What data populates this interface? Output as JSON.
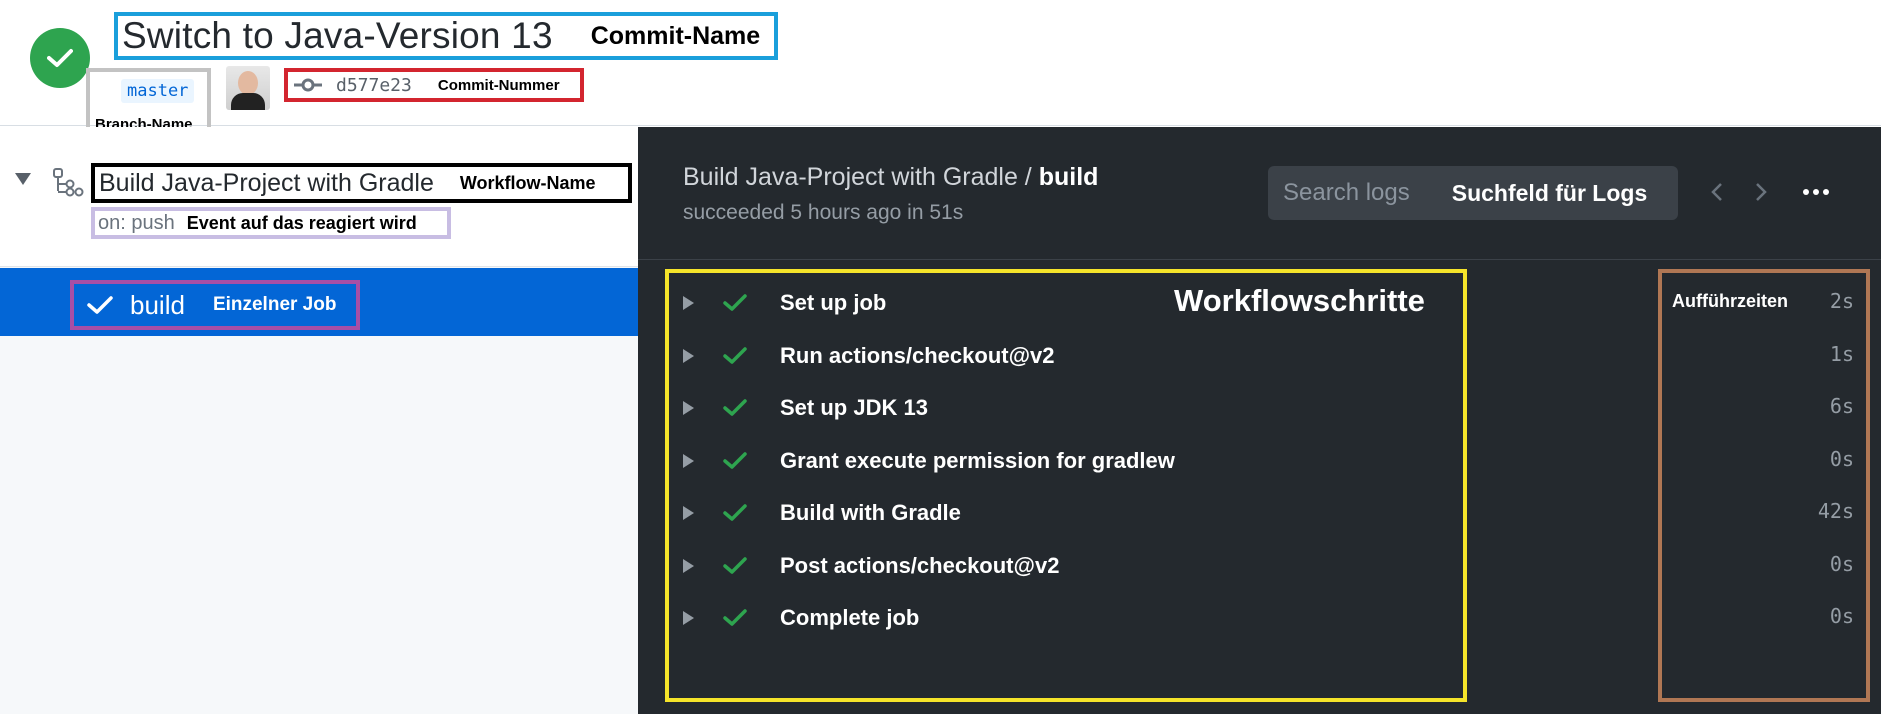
{
  "header": {
    "commit_title": "Switch to Java-Version 13",
    "commit_name_label": "Commit-Name",
    "branch": "master",
    "branch_label": "Branch-Name",
    "commit_hash": "d577e23",
    "commit_number_label": "Commit-Nummer",
    "status": "success"
  },
  "sidebar": {
    "workflow_title": "Build Java-Project with Gradle",
    "workflow_label": "Workflow-Name",
    "event_text": "on: push",
    "event_label": "Event auf das reagiert wird",
    "job_name": "build",
    "job_label": "Einzelner Job"
  },
  "log": {
    "title_prefix": "Build Java-Project with Gradle / ",
    "title_job": "build",
    "subtitle": "succeeded 5 hours ago in 51s",
    "search_placeholder": "Search logs",
    "search_label": "Suchfeld für Logs",
    "steps_label": "Workflowschritte",
    "times_label": "Aufführzeiten",
    "steps": [
      {
        "name": "Set up job",
        "time": "2s"
      },
      {
        "name": "Run actions/checkout@v2",
        "time": "1s"
      },
      {
        "name": "Set up JDK 13",
        "time": "6s"
      },
      {
        "name": "Grant execute permission for gradlew",
        "time": "0s"
      },
      {
        "name": "Build with Gradle",
        "time": "42s"
      },
      {
        "name": "Post actions/checkout@v2",
        "time": "0s"
      },
      {
        "name": "Complete job",
        "time": "0s"
      }
    ]
  },
  "colors": {
    "success_green": "#2ea44f",
    "selected_blue": "#0366d6",
    "log_background": "#24292e",
    "commit_name_outline": "#1a9fdb",
    "branch_name_outline": "#c3c3c3",
    "commit_number_outline": "#d3252f",
    "workflow_name_outline": "#000000",
    "event_outline": "#c8bde3",
    "job_outline": "#a64fa6",
    "steps_outline": "#f5e42a",
    "times_outline": "#b07754"
  },
  "icons": {
    "status": "check-circle-icon",
    "commit": "git-commit-icon",
    "workflow": "workflow-icon",
    "collapse": "triangle-down-icon",
    "job": "check-icon",
    "step_expand": "triangle-right-icon",
    "step_status": "check-icon",
    "prev": "chevron-left-icon",
    "next": "chevron-right-icon",
    "more": "kebab-horizontal-icon"
  }
}
